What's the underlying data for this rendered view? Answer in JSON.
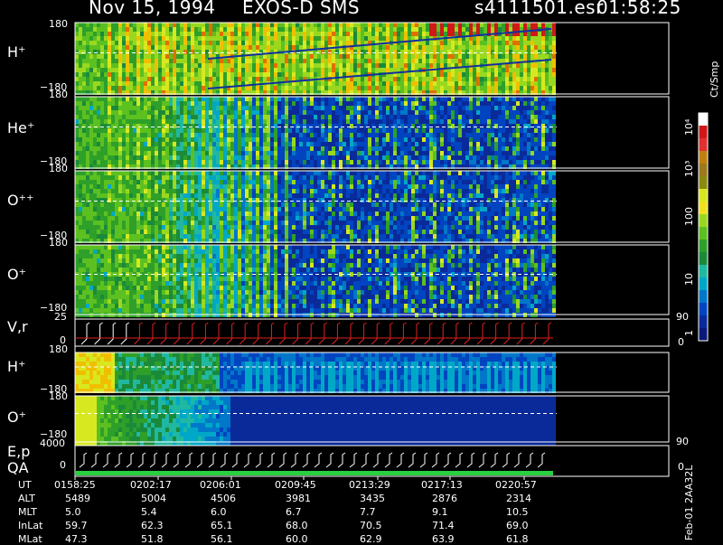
{
  "header": {
    "date": "Nov 15, 1994",
    "instrument": "EXOS-D SMS",
    "file": "s4111501.esr",
    "time": "01:58:25"
  },
  "colorbar": {
    "unit": "Ct/Smp",
    "ticks": [
      "10⁴",
      "10³",
      "100",
      "10",
      "1"
    ]
  },
  "panels": [
    {
      "label": "H⁺",
      "ymax": "180",
      "ymin": "−180"
    },
    {
      "label": "He⁺",
      "ymax": "180",
      "ymin": "−180"
    },
    {
      "label": "O⁺⁺",
      "ymax": "180",
      "ymin": "−180"
    },
    {
      "label": "O⁺",
      "ymax": "180",
      "ymin": "−180"
    },
    {
      "label": "V,r",
      "ymax": "25",
      "ymin": "0",
      "rmax": "90",
      "rmin": "0"
    },
    {
      "label": "H⁺",
      "ymax": "180",
      "ymin": "−180"
    },
    {
      "label": "O⁺",
      "ymax": "180",
      "ymin": "−180"
    },
    {
      "label": "E,p",
      "ymax": "4000",
      "ymin": "0",
      "rmax": "90",
      "rmin": "0"
    }
  ],
  "qa_label": "QA",
  "side_note": "Feb-01 2AA32L",
  "table": {
    "rows": [
      {
        "name": "UT",
        "values": [
          "0158:25",
          "0202:17",
          "0206:01",
          "0209:45",
          "0213:29",
          "0217:13",
          "0220:57"
        ]
      },
      {
        "name": "ALT",
        "values": [
          "5489",
          "5004",
          "4506",
          "3981",
          "3435",
          "2876",
          "2314"
        ]
      },
      {
        "name": "MLT",
        "values": [
          "5.0",
          "5.4",
          "6.0",
          "6.7",
          "7.7",
          "9.1",
          "10.5"
        ]
      },
      {
        "name": "InLat",
        "values": [
          "59.7",
          "62.3",
          "65.1",
          "68.0",
          "70.5",
          "71.4",
          "69.0"
        ]
      },
      {
        "name": "MLat",
        "values": [
          "47.3",
          "51.8",
          "56.1",
          "60.0",
          "62.9",
          "63.9",
          "61.8"
        ]
      }
    ]
  },
  "chart_data": {
    "type": "heatmap",
    "title": "Nov 15, 1994 EXOS-D SMS",
    "x_ticks": [
      "0158:25",
      "0202:17",
      "0206:01",
      "0209:45",
      "0213:29",
      "0217:13",
      "0220:57"
    ],
    "color_scale": {
      "label": "Ct/Smp",
      "log": true,
      "range": [
        1,
        10000
      ]
    },
    "series": [
      {
        "name": "H⁺",
        "ylim": [
          -180,
          180
        ],
        "note": "dense green/yellow counts throughout, two descending bands"
      },
      {
        "name": "He⁺",
        "ylim": [
          -180,
          180
        ],
        "note": "green/cyan early, mostly background after 0209"
      },
      {
        "name": "O⁺⁺",
        "ylim": [
          -180,
          180
        ],
        "note": "green/cyan early, mostly background after 0209"
      },
      {
        "name": "O⁺",
        "ylim": [
          -180,
          180
        ],
        "note": "green/cyan early, mostly background after 0209"
      },
      {
        "name": "V,r",
        "ylim": [
          0,
          25
        ],
        "right_ylim": [
          0,
          90
        ]
      },
      {
        "name": "H⁺",
        "ylim": [
          -180,
          180
        ],
        "note": "yellow near start, blue banded structure later"
      },
      {
        "name": "O⁺",
        "ylim": [
          -180,
          180
        ],
        "note": "yellow/green early, blue after 0206"
      },
      {
        "name": "E,p",
        "ylim": [
          0,
          4000
        ],
        "right_ylim": [
          0,
          90
        ]
      }
    ]
  }
}
